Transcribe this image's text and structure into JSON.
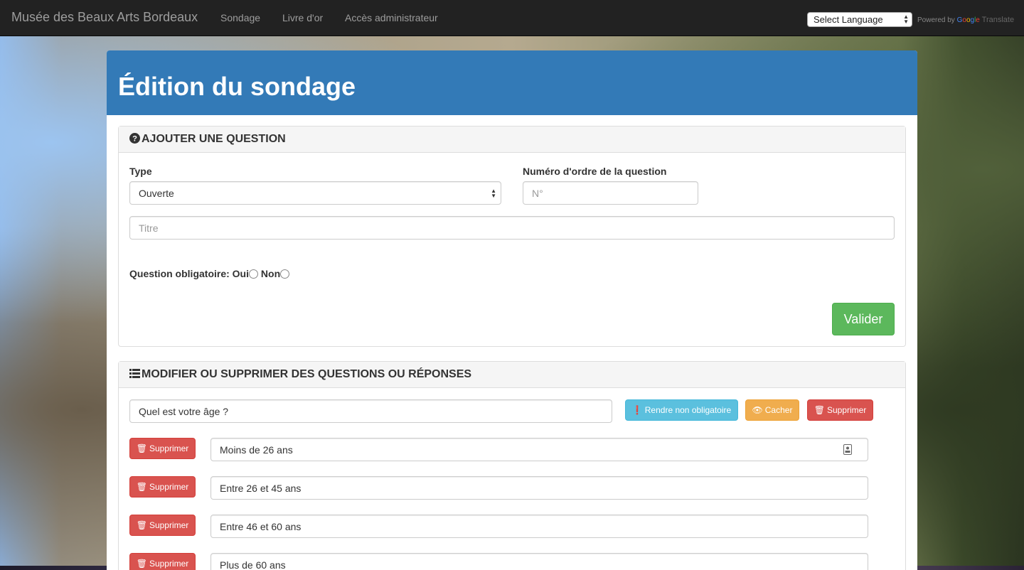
{
  "navbar": {
    "brand": "Musée des Beaux Arts Bordeaux",
    "links": [
      "Sondage",
      "Livre d'or",
      "Accès administrateur"
    ],
    "language_select": "Select Language",
    "powered_by": "Powered by",
    "google": [
      "G",
      "o",
      "o",
      "g",
      "l",
      "e"
    ],
    "translate": "Translate"
  },
  "page": {
    "title": "Édition du sondage"
  },
  "add_question": {
    "heading": "AJOUTER UNE QUESTION",
    "heading_icon": "question-circle-icon",
    "type_label": "Type",
    "type_value": "Ouverte",
    "order_label": "Numéro d'ordre de la question",
    "order_placeholder": "N°",
    "title_placeholder": "Titre",
    "mandatory_label": "Question obligatoire:",
    "option_yes": "Oui",
    "option_no": "Non",
    "submit": "Valider"
  },
  "edit_questions": {
    "heading": "MODIFIER OU SUPPRIMER DES QUESTIONS OU RÉPONSES",
    "heading_icon": "list-icon",
    "question": {
      "text": "Quel est votre âge ?",
      "btn_optional": "Rendre non obligatoire",
      "btn_hide": "Cacher",
      "btn_delete": "Supprimer"
    },
    "answers": [
      {
        "text": "Moins de 26 ans",
        "delete": "Supprimer"
      },
      {
        "text": "Entre 26 et 45 ans",
        "delete": "Supprimer"
      },
      {
        "text": "Entre 46 et 60 ans",
        "delete": "Supprimer"
      },
      {
        "text": "Plus de 60 ans",
        "delete": "Supprimer"
      }
    ]
  },
  "colors": {
    "navbar": "#222222",
    "primary": "#337ab7",
    "success": "#5cb85c",
    "info": "#5bc0de",
    "warning": "#f0ad4e",
    "danger": "#d9534f"
  }
}
